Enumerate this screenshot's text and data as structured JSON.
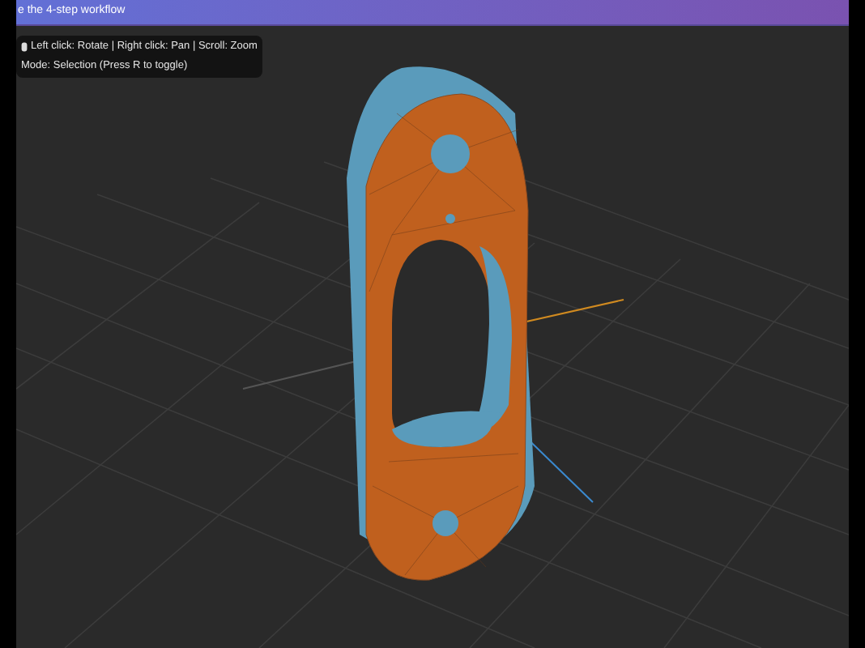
{
  "banner": {
    "text": "e the 4-step workflow"
  },
  "viewport_hint": {
    "lines": [
      "Left click: Rotate | Right click: Pan | Scroll: Zoom",
      "Mode: Selection (Press R to toggle)"
    ]
  }
}
